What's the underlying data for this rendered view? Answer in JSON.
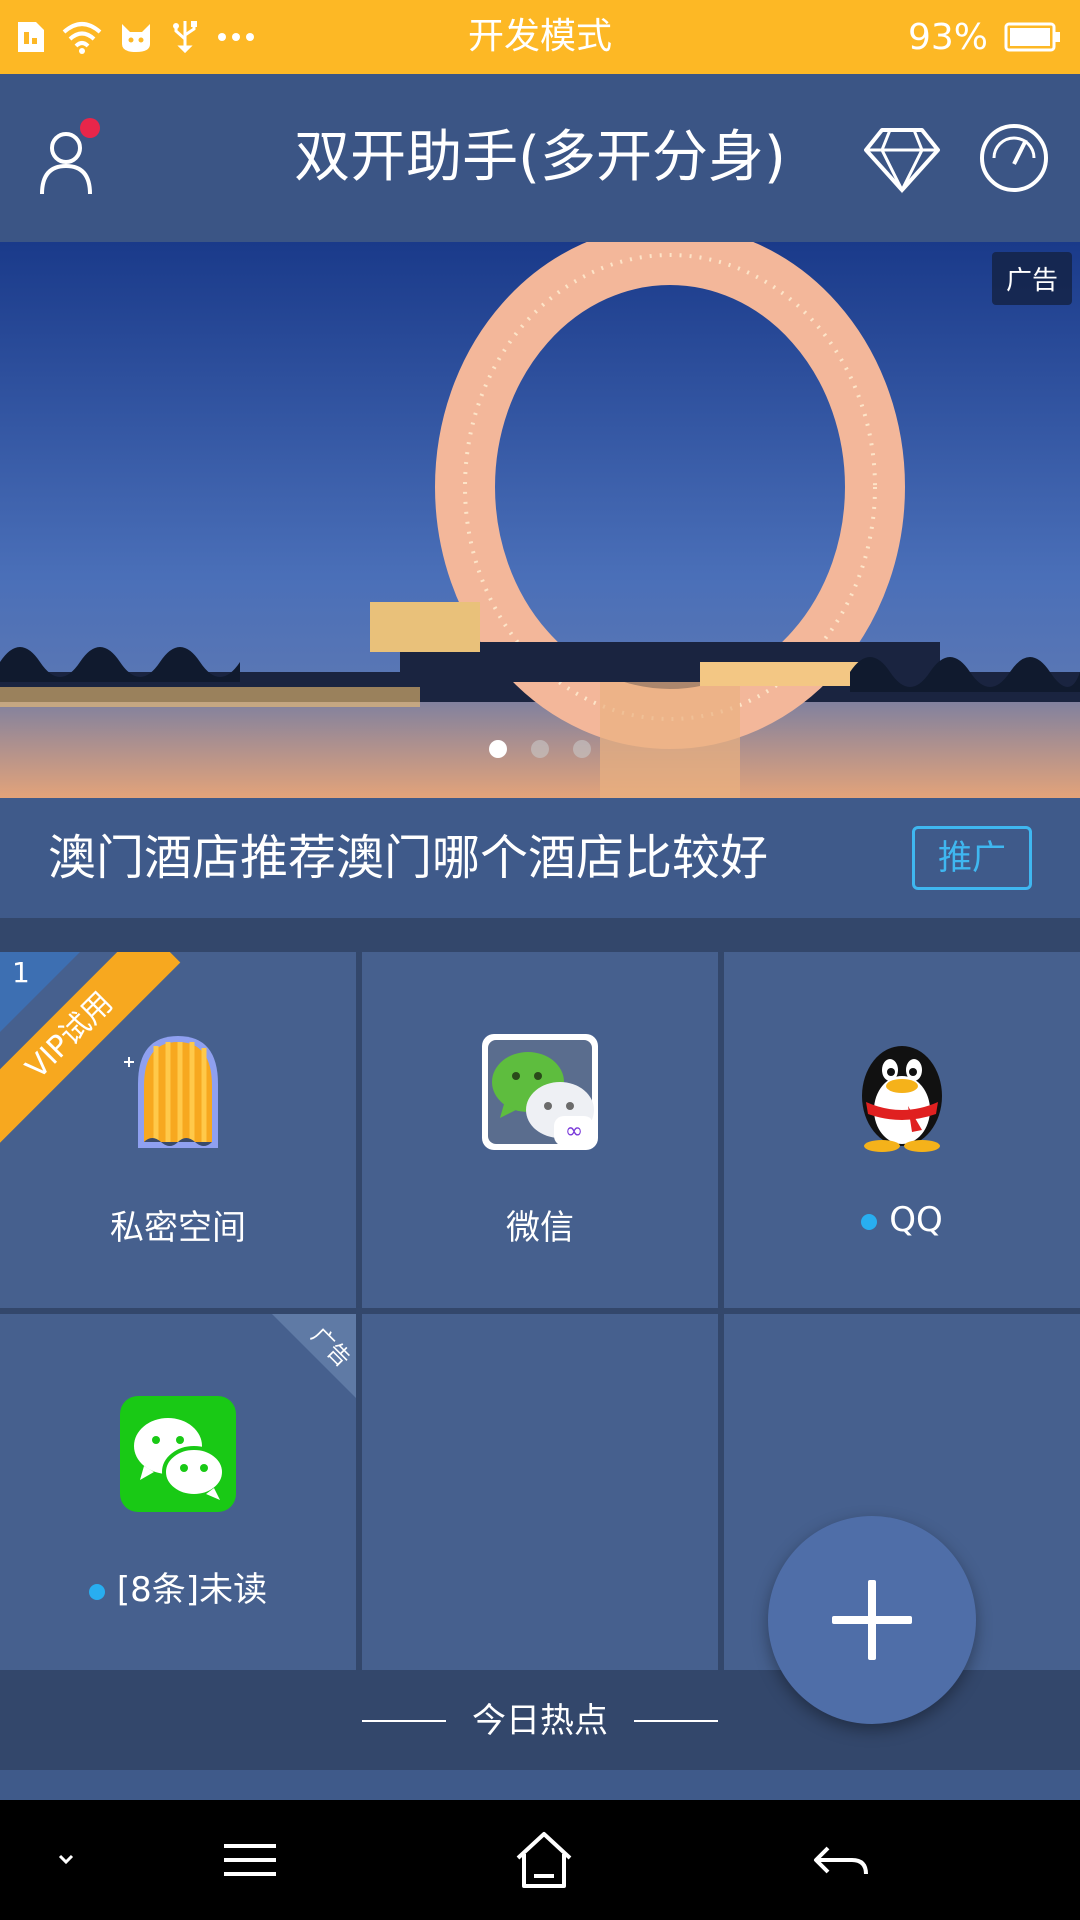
{
  "status_bar": {
    "title": "开发模式",
    "battery": "93%",
    "background": "#fdb825"
  },
  "header": {
    "title": "双开助手(多开分身)",
    "icons": [
      "user-icon",
      "diamond-icon",
      "speedometer-icon"
    ]
  },
  "banner": {
    "ad_label": "广告",
    "slide_count": 3,
    "active_slide": 1
  },
  "promo": {
    "text": "澳门酒店推荐澳门哪个酒店比较好",
    "tag": "推广"
  },
  "grid": {
    "cells": [
      {
        "label": "私密空间",
        "ribbon": "VIP试用",
        "ribbon_num": "1",
        "icon": "private-space-icon"
      },
      {
        "label": "微信",
        "icon": "wechat-clone-icon"
      },
      {
        "label": "QQ",
        "icon": "qq-penguin-icon",
        "dot": true
      },
      {
        "label": "[8条]未读",
        "icon": "wechat-icon",
        "dot": true,
        "corner": "广告"
      },
      {
        "label": ""
      },
      {
        "label": ""
      }
    ]
  },
  "hot": {
    "text": "今日热点"
  },
  "colors": {
    "accent_blue": "#28aef0",
    "header_bg": "#3b5585",
    "cell_bg": "#46608e",
    "vip_orange": "#f7a81f"
  }
}
